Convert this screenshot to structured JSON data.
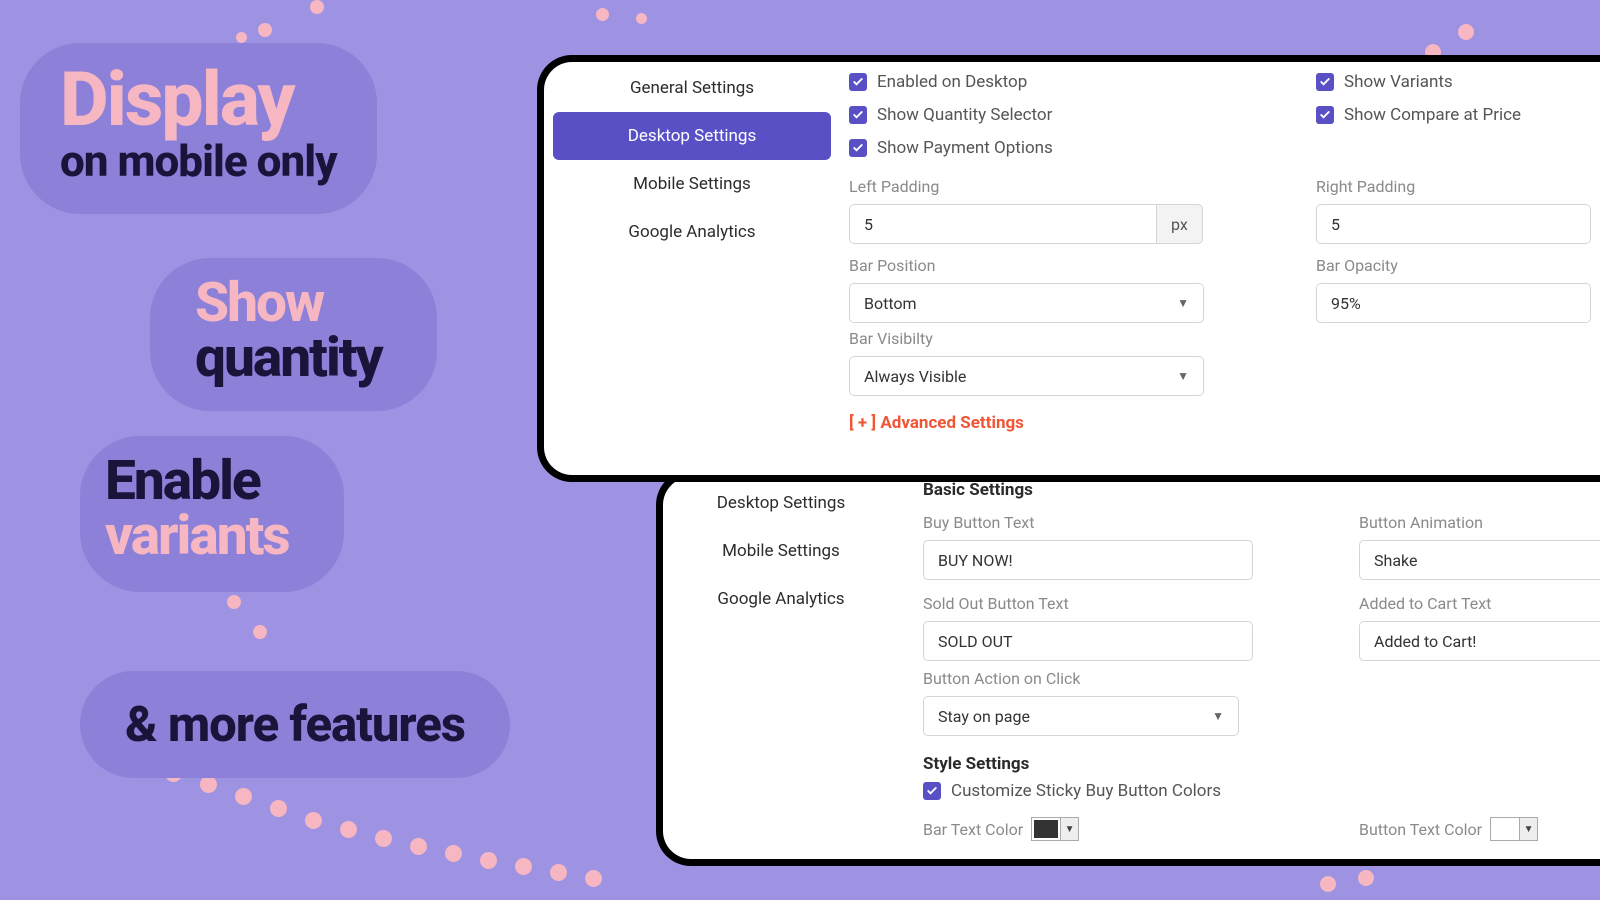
{
  "promo": {
    "p1_title": "Display",
    "p1_sub": "on mobile only",
    "p2_title": "Show",
    "p2_sub": "quantity",
    "p3_title": "Enable",
    "p3_sub": "variants",
    "p4": "& more features"
  },
  "nav1": {
    "general": "General Settings",
    "desktop": "Desktop Settings",
    "mobile": "Mobile Settings",
    "ga": "Google Analytics"
  },
  "nav2": {
    "desktop": "Desktop Settings",
    "mobile": "Mobile Settings",
    "ga": "Google Analytics"
  },
  "panel1": {
    "cb_enabled": "Enabled on Desktop",
    "cb_qty": "Show Quantity Selector",
    "cb_pay": "Show Payment Options",
    "cb_variants": "Show Variants",
    "cb_compare": "Show Compare at Price",
    "left_padding_label": "Left Padding",
    "left_padding_value": "5",
    "px": "px",
    "right_padding_label": "Right Padding",
    "right_padding_value": "5",
    "bar_position_label": "Bar Position",
    "bar_position_value": "Bottom",
    "bar_opacity_label": "Bar Opacity",
    "bar_opacity_value": "95%",
    "bar_visibility_label": "Bar Visibilty",
    "bar_visibility_value": "Always Visible",
    "advanced": "[ + ] Advanced Settings"
  },
  "panel2": {
    "basic_title": "Basic Settings",
    "buy_label": "Buy Button Text",
    "buy_value": "BUY NOW!",
    "anim_label": "Button Animation",
    "anim_value": "Shake",
    "sold_label": "Sold Out Button Text",
    "sold_value": "SOLD OUT",
    "added_label": "Added to Cart Text",
    "added_value": "Added to Cart!",
    "action_label": "Button Action on Click",
    "action_value": "Stay on page",
    "style_title": "Style Settings",
    "cb_custom": "Customize Sticky Buy Button Colors",
    "bar_text_color": "Bar Text Color",
    "button_text_color": "Button Text Color"
  }
}
